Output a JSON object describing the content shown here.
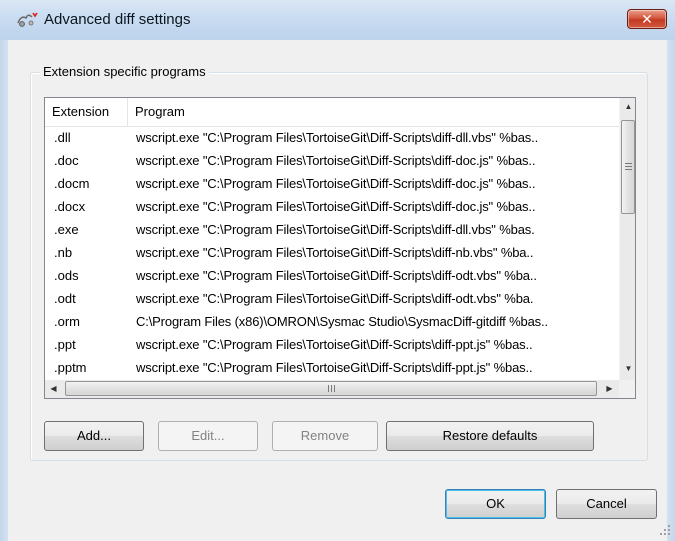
{
  "window": {
    "title": "Advanced diff settings",
    "close_glyph": "✕"
  },
  "group": {
    "label": "Extension specific programs"
  },
  "list": {
    "columns": [
      "Extension",
      "Program"
    ],
    "rows": [
      {
        "ext": ".dll",
        "program": "wscript.exe \"C:\\Program Files\\TortoiseGit\\Diff-Scripts\\diff-dll.vbs\" %bas.."
      },
      {
        "ext": ".doc",
        "program": "wscript.exe \"C:\\Program Files\\TortoiseGit\\Diff-Scripts\\diff-doc.js\" %bas.."
      },
      {
        "ext": ".docm",
        "program": "wscript.exe \"C:\\Program Files\\TortoiseGit\\Diff-Scripts\\diff-doc.js\" %bas.."
      },
      {
        "ext": ".docx",
        "program": "wscript.exe \"C:\\Program Files\\TortoiseGit\\Diff-Scripts\\diff-doc.js\" %bas.."
      },
      {
        "ext": ".exe",
        "program": "wscript.exe \"C:\\Program Files\\TortoiseGit\\Diff-Scripts\\diff-dll.vbs\" %bas."
      },
      {
        "ext": ".nb",
        "program": "wscript.exe \"C:\\Program Files\\TortoiseGit\\Diff-Scripts\\diff-nb.vbs\" %ba.."
      },
      {
        "ext": ".ods",
        "program": "wscript.exe \"C:\\Program Files\\TortoiseGit\\Diff-Scripts\\diff-odt.vbs\" %ba.."
      },
      {
        "ext": ".odt",
        "program": "wscript.exe \"C:\\Program Files\\TortoiseGit\\Diff-Scripts\\diff-odt.vbs\" %ba."
      },
      {
        "ext": ".orm",
        "program": "C:\\Program Files (x86)\\OMRON\\Sysmac Studio\\SysmacDiff-gitdiff %bas.."
      },
      {
        "ext": ".ppt",
        "program": "wscript.exe \"C:\\Program Files\\TortoiseGit\\Diff-Scripts\\diff-ppt.js\" %bas.."
      },
      {
        "ext": ".pptm",
        "program": "wscript.exe \"C:\\Program Files\\TortoiseGit\\Diff-Scripts\\diff-ppt.js\" %bas.."
      }
    ]
  },
  "scrollbar": {
    "up_glyph": "▲",
    "down_glyph": "▼",
    "left_glyph": "◀",
    "right_glyph": "▶"
  },
  "buttons": {
    "add": "Add...",
    "edit": "Edit...",
    "remove": "Remove",
    "restore": "Restore defaults",
    "ok": "OK",
    "cancel": "Cancel"
  },
  "icons": {
    "app": "tortoisegit-diff-icon",
    "close": "close-icon",
    "resize": "resize-grip-icon"
  },
  "colors": {
    "close_button": "#c23b22",
    "default_button_border": "#3c7fb1",
    "titlebar": "#c9dcf1"
  }
}
